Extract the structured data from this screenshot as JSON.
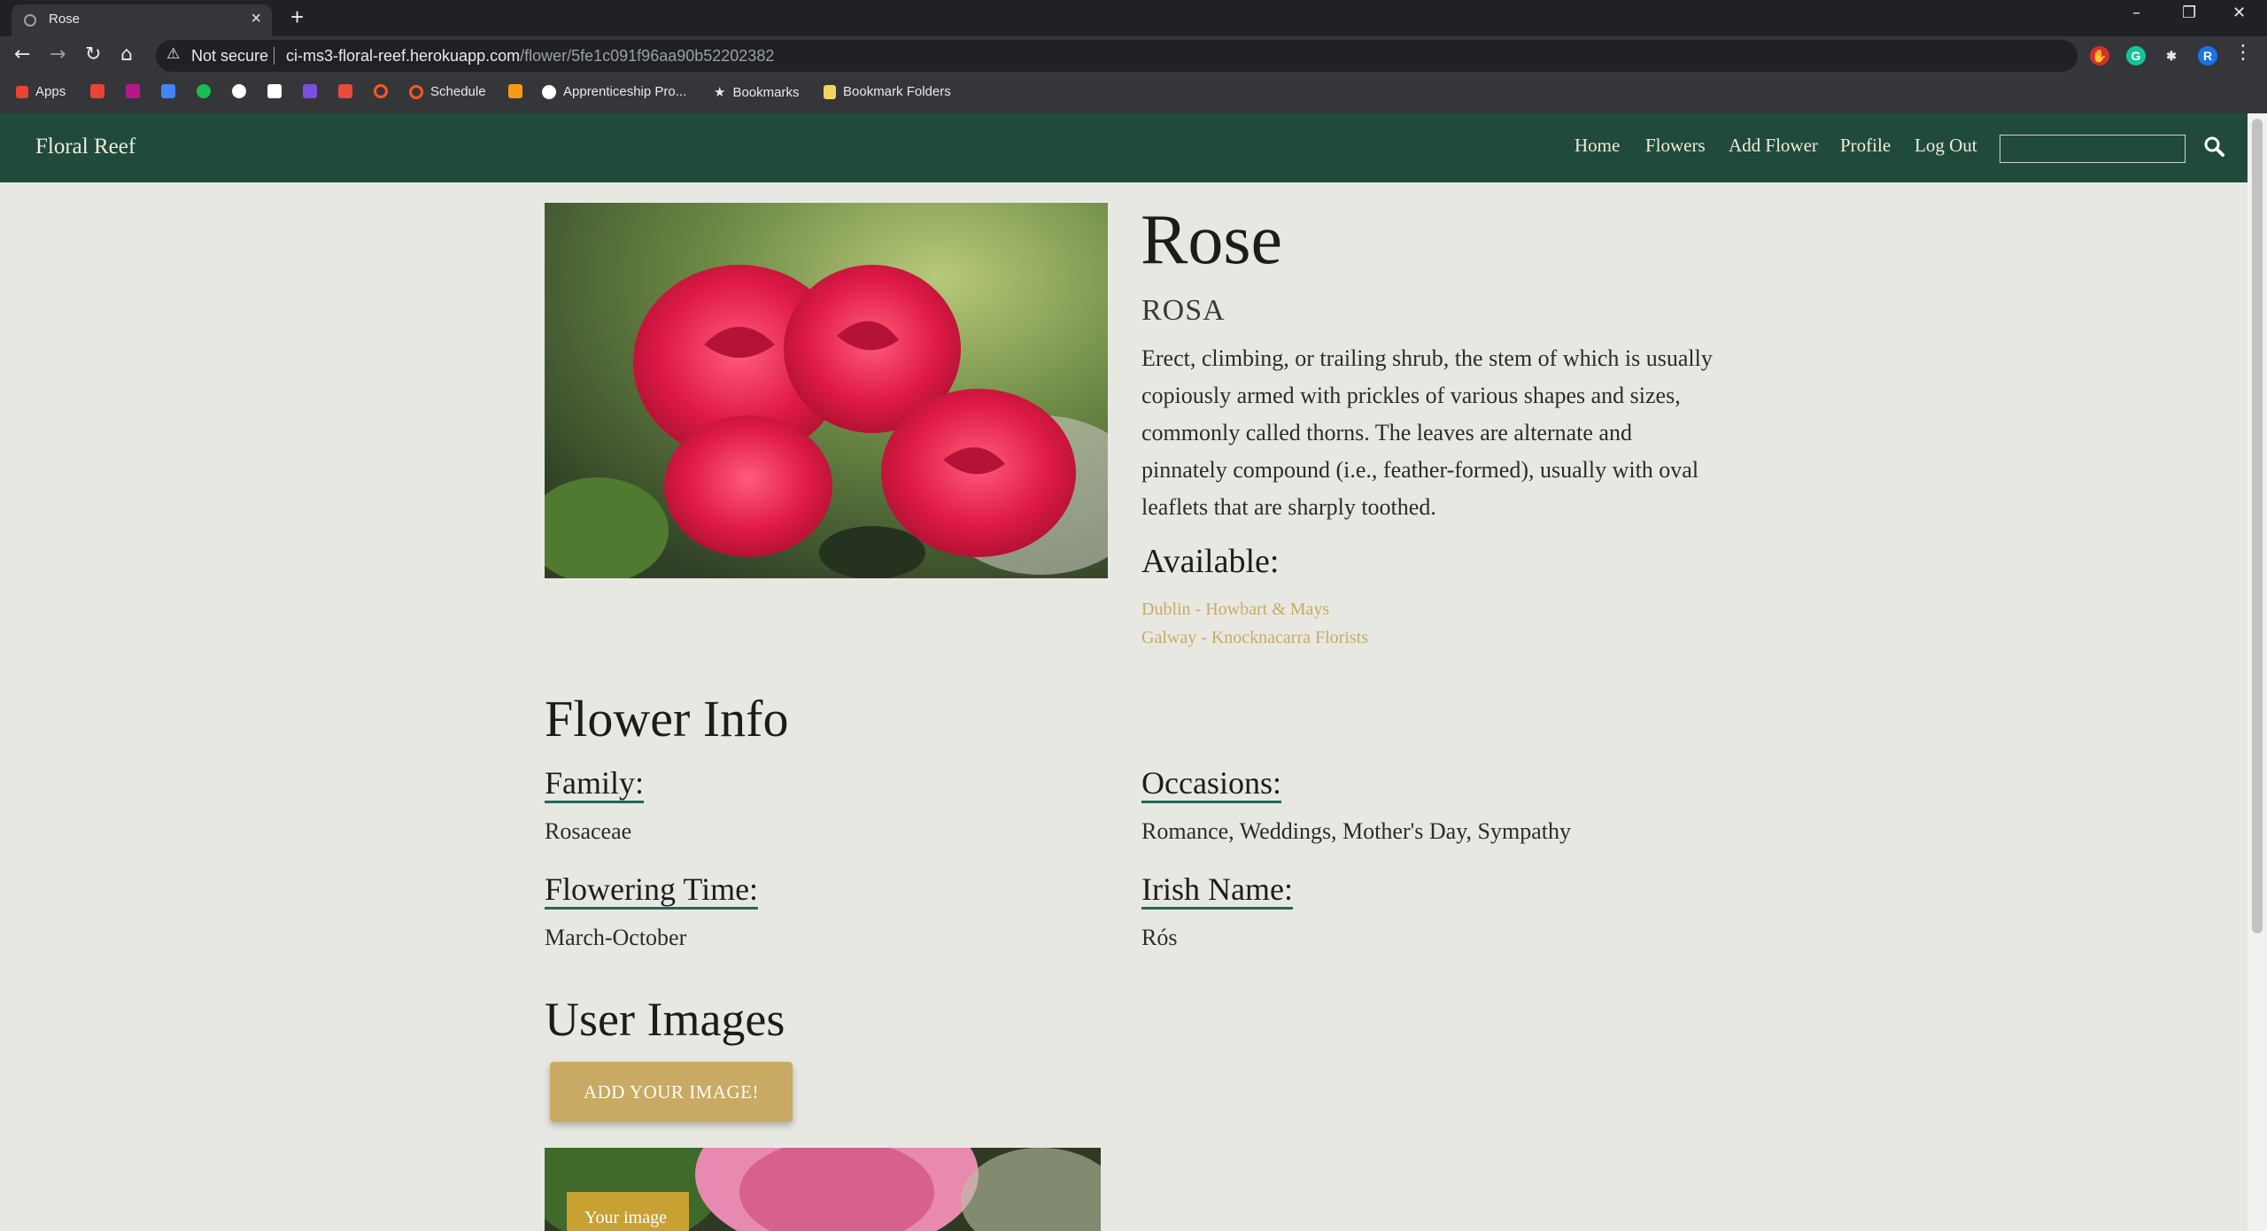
{
  "browser": {
    "tab_title": "Rose",
    "tab_close": "×",
    "new_tab": "+",
    "window_controls": [
      "–",
      "❐",
      "✕"
    ],
    "security_label": "Not secure",
    "url_host": "ci-ms3-floral-reef.herokuapp.com",
    "url_path": "/flower/5fe1c091f96aa90b52202382",
    "bookmarks": [
      {
        "label": "Apps",
        "icon": "apps-grid-icon",
        "color": "#ea4335"
      },
      {
        "label": "",
        "icon": "gmail-icon",
        "color": "#ea4335"
      },
      {
        "label": "",
        "icon": "extension-icon",
        "color": "#b5168b"
      },
      {
        "label": "",
        "icon": "calendar-icon",
        "color": "#4285f4"
      },
      {
        "label": "",
        "icon": "spotify-icon",
        "color": "#1db954"
      },
      {
        "label": "",
        "icon": "github-icon",
        "color": "#ffffff"
      },
      {
        "label": "",
        "icon": "docs-icon",
        "color": "#ffffff"
      },
      {
        "label": "",
        "icon": "list-icon",
        "color": "#7b4fe0"
      },
      {
        "label": "",
        "icon": "puzzle-icon",
        "color": "#e84b3c"
      },
      {
        "label": "",
        "icon": "ring-icon",
        "color": "#ff5722"
      },
      {
        "label": "Schedule",
        "icon": "schedule-icon",
        "color": "#ff5722"
      },
      {
        "label": "",
        "icon": "app-icon",
        "color": "#f39c12"
      },
      {
        "label": "Apprenticeship Pro...",
        "icon": "google-icon",
        "color": "#ffffff"
      },
      {
        "label": "Bookmarks",
        "icon": "star-icon",
        "color": "#e8eaed"
      },
      {
        "label": "Bookmark Folders",
        "icon": "folder-icon",
        "color": "#f4d35e"
      }
    ],
    "profile_initial": "R"
  },
  "site_nav": {
    "brand": "Floral Reef",
    "links": [
      "Home",
      "Flowers",
      "Add Flower",
      "Profile",
      "Log Out"
    ],
    "search_placeholder": ""
  },
  "flower": {
    "name": "Rose",
    "latin_name": "ROSA",
    "description": "Erect, climbing, or trailing shrub, the stem of which is usually copiously armed with prickles of various shapes and sizes, commonly called thorns. The leaves are alternate and pinnately compound (i.e., feather-formed), usually with oval leaflets that are sharply toothed.",
    "available_heading": "Available:",
    "shops": [
      "Dublin - Howbart & Mays",
      "Galway - Knocknacarra Florists"
    ]
  },
  "info": {
    "heading": "Flower Info",
    "family_label": "Family:",
    "family_value": "Rosaceae",
    "occasions_label": "Occasions:",
    "occasions_value": "Romance, Weddings, Mother's Day, Sympathy",
    "flowering_label": "Flowering Time:",
    "flowering_value": "March-October",
    "irish_label": "Irish Name:",
    "irish_value": "Rós"
  },
  "user_images": {
    "heading": "User Images",
    "add_button": "ADD YOUR IMAGE!",
    "image_tag": "Your image"
  },
  "colors": {
    "nav_bg": "#1f4a3c",
    "page_bg": "#e8e8e3",
    "accent_gold": "#c9aa64",
    "underline_teal": "#1f6a5a"
  }
}
